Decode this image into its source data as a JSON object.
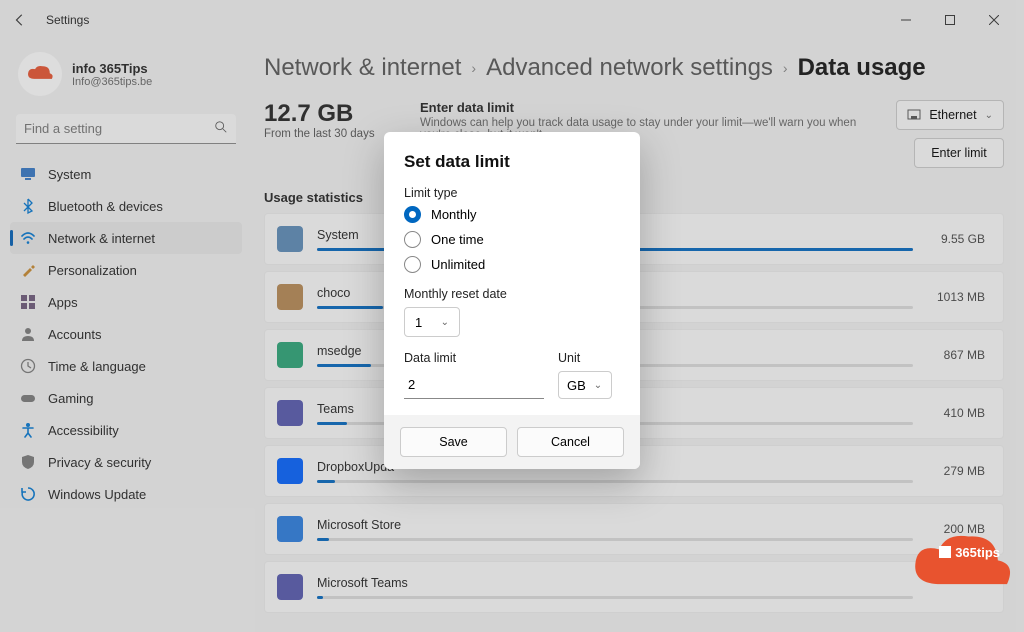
{
  "titlebar": {
    "title": "Settings"
  },
  "profile": {
    "name": "info 365Tips",
    "email": "Info@365tips.be"
  },
  "search": {
    "placeholder": "Find a setting"
  },
  "sidebar": {
    "items": [
      {
        "label": "System",
        "icon": "monitor",
        "color": "#3478c7"
      },
      {
        "label": "Bluetooth & devices",
        "icon": "bluetooth",
        "color": "#0078d4"
      },
      {
        "label": "Network & internet",
        "icon": "wifi",
        "color": "#0078d4",
        "selected": true
      },
      {
        "label": "Personalization",
        "icon": "brush",
        "color": "#c98a2d"
      },
      {
        "label": "Apps",
        "icon": "grid",
        "color": "#6d597a"
      },
      {
        "label": "Accounts",
        "icon": "person",
        "color": "#7a7a7a"
      },
      {
        "label": "Time & language",
        "icon": "clock",
        "color": "#7a7a7a"
      },
      {
        "label": "Gaming",
        "icon": "gamepad",
        "color": "#7a7a7a"
      },
      {
        "label": "Accessibility",
        "icon": "access",
        "color": "#0078d4"
      },
      {
        "label": "Privacy & security",
        "icon": "shield",
        "color": "#7a7a7a"
      },
      {
        "label": "Windows Update",
        "icon": "update",
        "color": "#0078d4"
      }
    ]
  },
  "breadcrumbs": {
    "a": "Network & internet",
    "b": "Advanced network settings",
    "c": "Data usage"
  },
  "summary": {
    "total": "12.7 GB",
    "period": "From the last 30 days",
    "limit_title": "Enter data limit",
    "limit_desc": "Windows can help you track data usage to stay under your limit—we'll warn you when you're close, but it won't",
    "adapter": "Ethernet",
    "enter_btn": "Enter limit"
  },
  "stats_heading": "Usage statistics",
  "apps": [
    {
      "name": "System",
      "value": "9.55 GB",
      "pct": 100,
      "color": "#5b8bb8"
    },
    {
      "name": "choco",
      "value": "1013 MB",
      "pct": 11,
      "color": "#b78853"
    },
    {
      "name": "msedge",
      "value": "867 MB",
      "pct": 9,
      "color": "#2aa477"
    },
    {
      "name": "Teams",
      "value": "410 MB",
      "pct": 5,
      "color": "#5558af"
    },
    {
      "name": "DropboxUpda",
      "value": "279 MB",
      "pct": 3,
      "color": "#0061ff"
    },
    {
      "name": "Microsoft Store",
      "value": "200 MB",
      "pct": 2,
      "color": "#2a7de1"
    },
    {
      "name": "Microsoft Teams",
      "value": "",
      "pct": 1,
      "color": "#5558af"
    }
  ],
  "dialog": {
    "title": "Set data limit",
    "limit_type_label": "Limit type",
    "radios": {
      "monthly": "Monthly",
      "onetime": "One time",
      "unlimited": "Unlimited"
    },
    "reset_label": "Monthly reset date",
    "reset_value": "1",
    "data_label": "Data limit",
    "data_value": "2",
    "unit_label": "Unit",
    "unit_value": "GB",
    "save": "Save",
    "cancel": "Cancel"
  },
  "watermark": "365tips"
}
